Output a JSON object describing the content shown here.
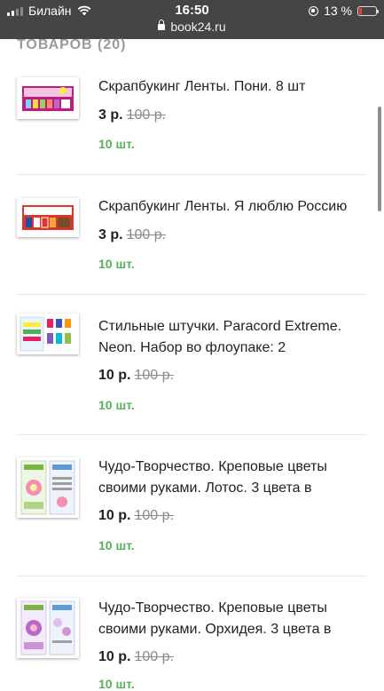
{
  "statusbar": {
    "carrier": "Билайн",
    "time": "16:50",
    "url": "book24.ru",
    "battery": "13 %"
  },
  "section": {
    "title": "ТОВАРОВ (20)"
  },
  "items": [
    {
      "title": "Скрапбукинг Ленты. Пони. 8 шт",
      "price": "3 р.",
      "old_price": "100 р.",
      "stock": "10 шт."
    },
    {
      "title": "Скрапбукинг Ленты. Я люблю Россию",
      "price": "3 р.",
      "old_price": "100 р.",
      "stock": "10 шт."
    },
    {
      "title": "Стильные штучки. Paracord Extreme. Neon. Набор во флоупаке: 2",
      "price": "10 р.",
      "old_price": "100 р.",
      "stock": "10 шт."
    },
    {
      "title": "Чудо-Творчество. Креповые цветы своими руками. Лотос. 3 цвета в",
      "price": "10 р.",
      "old_price": "100 р.",
      "stock": "10 шт."
    },
    {
      "title": "Чудо-Творчество. Креповые цветы своими руками. Орхидея. 3 цвета в",
      "price": "10 р.",
      "old_price": "100 р.",
      "stock": "10 шт."
    }
  ],
  "colors": {
    "stock_green": "#58b05f",
    "statusbar_bg": "#454545",
    "muted_title": "#9a9a9a"
  }
}
